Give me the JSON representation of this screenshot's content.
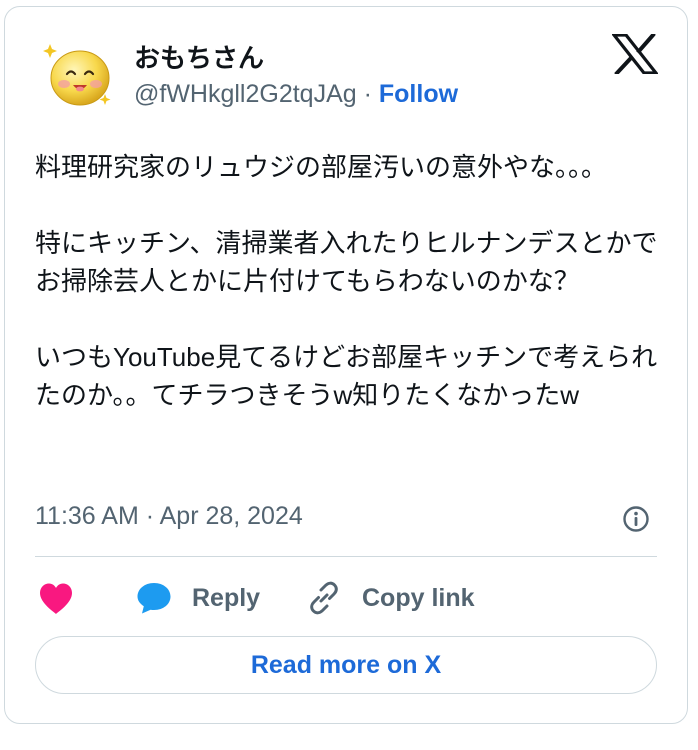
{
  "author": {
    "display_name": "おもちさん",
    "handle": "@fWHkgll2G2tqJAg",
    "separator": " · ",
    "follow_label": "Follow"
  },
  "tweet": {
    "text": "料理研究家のリュウジの部屋汚いの意外やな。。。\n\n特にキッチン、清掃業者入れたりヒルナンデスとかでお掃除芸人とかに片付けてもらわないのかな？\n\nいつもYouTube見てるけどお部屋キッチンで考えられたのか。。てチラつきそうw知りたくなかったw",
    "timestamp": "11:36 AM · Apr 28, 2024"
  },
  "actions": {
    "reply_label": "Reply",
    "copy_link_label": "Copy link",
    "read_more_label": "Read more on X"
  },
  "colors": {
    "link_blue": "#1d6ad8",
    "like_pink": "#f91880",
    "reply_blue": "#1d9bf0",
    "muted_gray": "#536471",
    "border": "#cfd9de"
  },
  "icons": {
    "avatar": "smiley-face-sparkles-icon",
    "brand": "x-logo-icon",
    "info": "info-icon",
    "like": "heart-icon",
    "reply": "speech-bubble-icon",
    "copy_link": "link-icon"
  }
}
